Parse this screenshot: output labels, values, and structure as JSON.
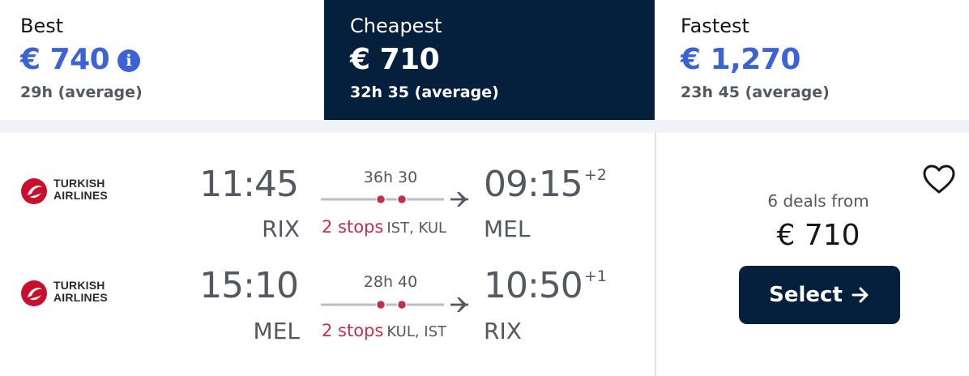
{
  "tabs": [
    {
      "label": "Best",
      "price": "€ 740",
      "avg": "29h (average)"
    },
    {
      "label": "Cheapest",
      "price": "€ 710",
      "avg": "32h 35 (average)"
    },
    {
      "label": "Fastest",
      "price": "€ 1,270",
      "avg": "23h 45 (average)"
    }
  ],
  "legs": [
    {
      "airline_line1": "TURKISH",
      "airline_line2": "AIRLINES",
      "dep_time": "11:45",
      "dep_code": "RIX",
      "duration": "36h 30",
      "stops": "2 stops",
      "via": "IST, KUL",
      "arr_time": "09:15",
      "day_offset": "+2",
      "arr_code": "MEL"
    },
    {
      "airline_line1": "TURKISH",
      "airline_line2": "AIRLINES",
      "dep_time": "15:10",
      "dep_code": "MEL",
      "duration": "28h 40",
      "stops": "2 stops",
      "via": "KUL, IST",
      "arr_time": "10:50",
      "day_offset": "+1",
      "arr_code": "RIX"
    }
  ],
  "price_panel": {
    "deals": "6 deals from",
    "price": "€ 710",
    "select_label": "Select"
  },
  "colors": {
    "brand_dark": "#05203c",
    "price_blue": "#3b63d6",
    "stops_red": "#c0314b",
    "airline_red": "#c8102e"
  },
  "icons": [
    "info-icon",
    "airline-logo-icon",
    "plane-icon",
    "heart-icon",
    "arrow-right-icon"
  ]
}
